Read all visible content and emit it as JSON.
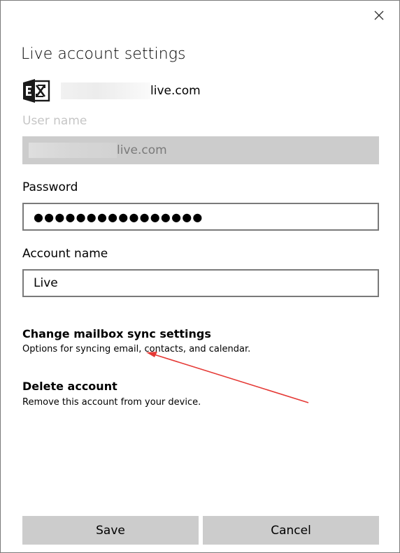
{
  "dialog": {
    "title": "Live account settings",
    "close_icon": "close-icon"
  },
  "account": {
    "icon": "exchange-icon",
    "email_suffix": "live.com"
  },
  "user_name": {
    "label": "User name",
    "value_suffix": "live.com"
  },
  "password": {
    "label": "Password",
    "value": "●●●●●●●●●●●●●●●●"
  },
  "account_name": {
    "label": "Account name",
    "value": "Live"
  },
  "sync_settings": {
    "title": "Change mailbox sync settings",
    "description": "Options for syncing email, contacts, and calendar."
  },
  "delete_account": {
    "title": "Delete account",
    "description": "Remove this account from your device."
  },
  "buttons": {
    "save": "Save",
    "cancel": "Cancel"
  },
  "colors": {
    "button_bg": "#cccccc",
    "disabled_text": "#c6c6c6",
    "input_border": "#7a7a7a",
    "annotation_arrow": "#e53935"
  }
}
